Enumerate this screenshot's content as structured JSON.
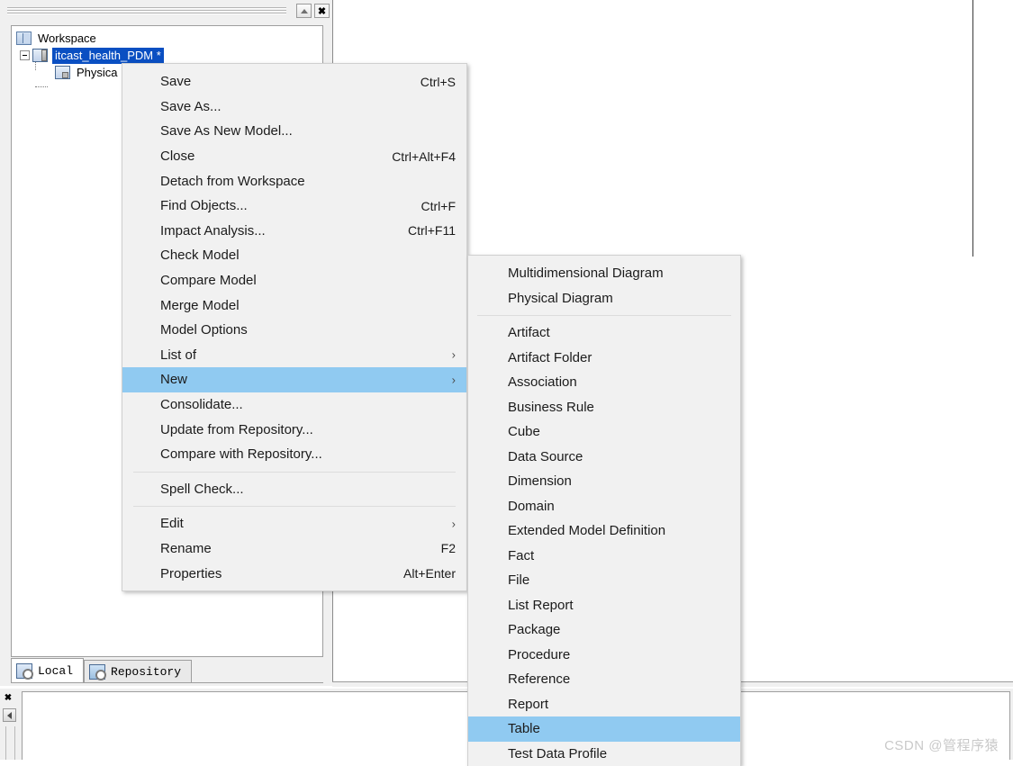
{
  "browser_panel": {
    "autohide_tooltip": "Auto Hide",
    "close_tooltip": "Close",
    "tree": {
      "root_label": "Workspace",
      "model_label": "itcast_health_PDM *",
      "child_label": "Physica"
    },
    "tabs": [
      {
        "label": "Local",
        "icon": "local-workspace-icon",
        "active": true
      },
      {
        "label": "Repository",
        "icon": "repository-icon",
        "active": false
      }
    ],
    "scroll_left_glyph": "‹"
  },
  "output_panel": {
    "close_glyph": "✖"
  },
  "context_menu": {
    "items": [
      {
        "label": "Save",
        "accel": "Ctrl+S"
      },
      {
        "label": "Save As...",
        "accel": ""
      },
      {
        "label": "Save As New Model...",
        "accel": ""
      },
      {
        "label": "Close",
        "accel": "Ctrl+Alt+F4"
      },
      {
        "label": "Detach from Workspace",
        "accel": ""
      },
      {
        "label": "Find Objects...",
        "accel": "Ctrl+F"
      },
      {
        "label": "Impact Analysis...",
        "accel": "Ctrl+F11"
      },
      {
        "label": "Check Model",
        "accel": ""
      },
      {
        "label": "Compare Model",
        "accel": ""
      },
      {
        "label": "Merge Model",
        "accel": ""
      },
      {
        "label": "Model Options",
        "accel": ""
      },
      {
        "label": "List of",
        "accel": "",
        "submenu": true
      },
      {
        "label": "New",
        "accel": "",
        "submenu": true,
        "highlighted": true
      },
      {
        "label": "Consolidate...",
        "accel": ""
      },
      {
        "label": "Update from Repository...",
        "accel": ""
      },
      {
        "label": "Compare with Repository...",
        "accel": ""
      },
      {
        "separator": true
      },
      {
        "label": "Spell Check...",
        "accel": ""
      },
      {
        "separator": true
      },
      {
        "label": "Edit",
        "accel": "",
        "submenu": true
      },
      {
        "label": "Rename",
        "accel": "F2"
      },
      {
        "label": "Properties",
        "accel": "Alt+Enter"
      }
    ]
  },
  "submenu_new": {
    "items": [
      {
        "label": "Multidimensional Diagram"
      },
      {
        "label": "Physical Diagram"
      },
      {
        "separator": true
      },
      {
        "label": "Artifact"
      },
      {
        "label": "Artifact Folder"
      },
      {
        "label": "Association"
      },
      {
        "label": "Business Rule"
      },
      {
        "label": "Cube"
      },
      {
        "label": "Data Source"
      },
      {
        "label": "Dimension"
      },
      {
        "label": "Domain"
      },
      {
        "label": "Extended Model Definition"
      },
      {
        "label": "Fact"
      },
      {
        "label": "File"
      },
      {
        "label": "List Report"
      },
      {
        "label": "Package"
      },
      {
        "label": "Procedure"
      },
      {
        "label": "Reference"
      },
      {
        "label": "Report"
      },
      {
        "label": "Table",
        "highlighted": true
      },
      {
        "label": "Test Data Profile"
      }
    ]
  },
  "watermark": {
    "text": "CSDN @管程序猿"
  },
  "colors": {
    "menu_background": "#f1f1f1",
    "menu_highlight": "#90caf1",
    "tree_selection": "#0a4fc2",
    "panel_background": "#f0f0f0"
  }
}
